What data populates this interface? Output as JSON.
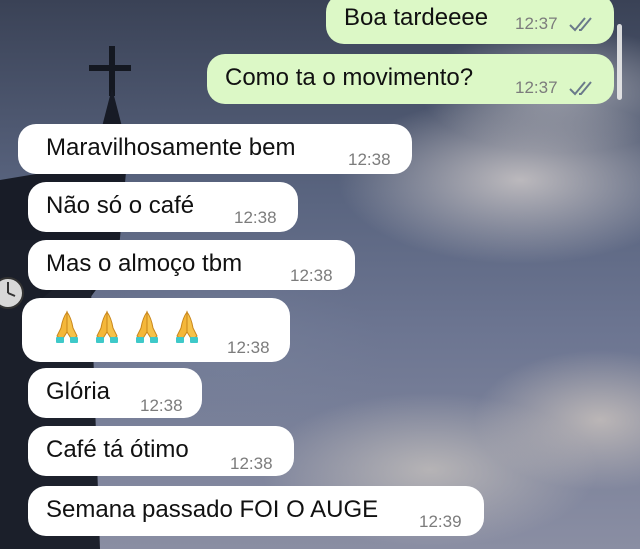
{
  "colors": {
    "outgoing_bubble": "#dcf8c6",
    "incoming_bubble": "#ffffff",
    "timestamp": "#7c7c7c",
    "read_ticks": "#6a7a8a"
  },
  "messages": [
    {
      "direction": "outgoing",
      "text": "Boa tardeeee",
      "time": "12:37",
      "status_icon": "double-check-icon"
    },
    {
      "direction": "outgoing",
      "text": "Como ta o movimento?",
      "time": "12:37",
      "status_icon": "double-check-icon"
    },
    {
      "direction": "incoming",
      "text": "Maravilhosamente bem",
      "time": "12:38"
    },
    {
      "direction": "incoming",
      "text": "Não só o café",
      "time": "12:38"
    },
    {
      "direction": "incoming",
      "text": "Mas o almoço tbm",
      "time": "12:38"
    },
    {
      "direction": "incoming",
      "text": "",
      "emoji": "folded-hands-icon",
      "emoji_count": 4,
      "time": "12:38"
    },
    {
      "direction": "incoming",
      "text": "Glória",
      "time": "12:38"
    },
    {
      "direction": "incoming",
      "text": "Café tá ótimo",
      "time": "12:38"
    },
    {
      "direction": "incoming",
      "text": "Semana passado FOI O AUGE",
      "time": "12:39"
    }
  ]
}
